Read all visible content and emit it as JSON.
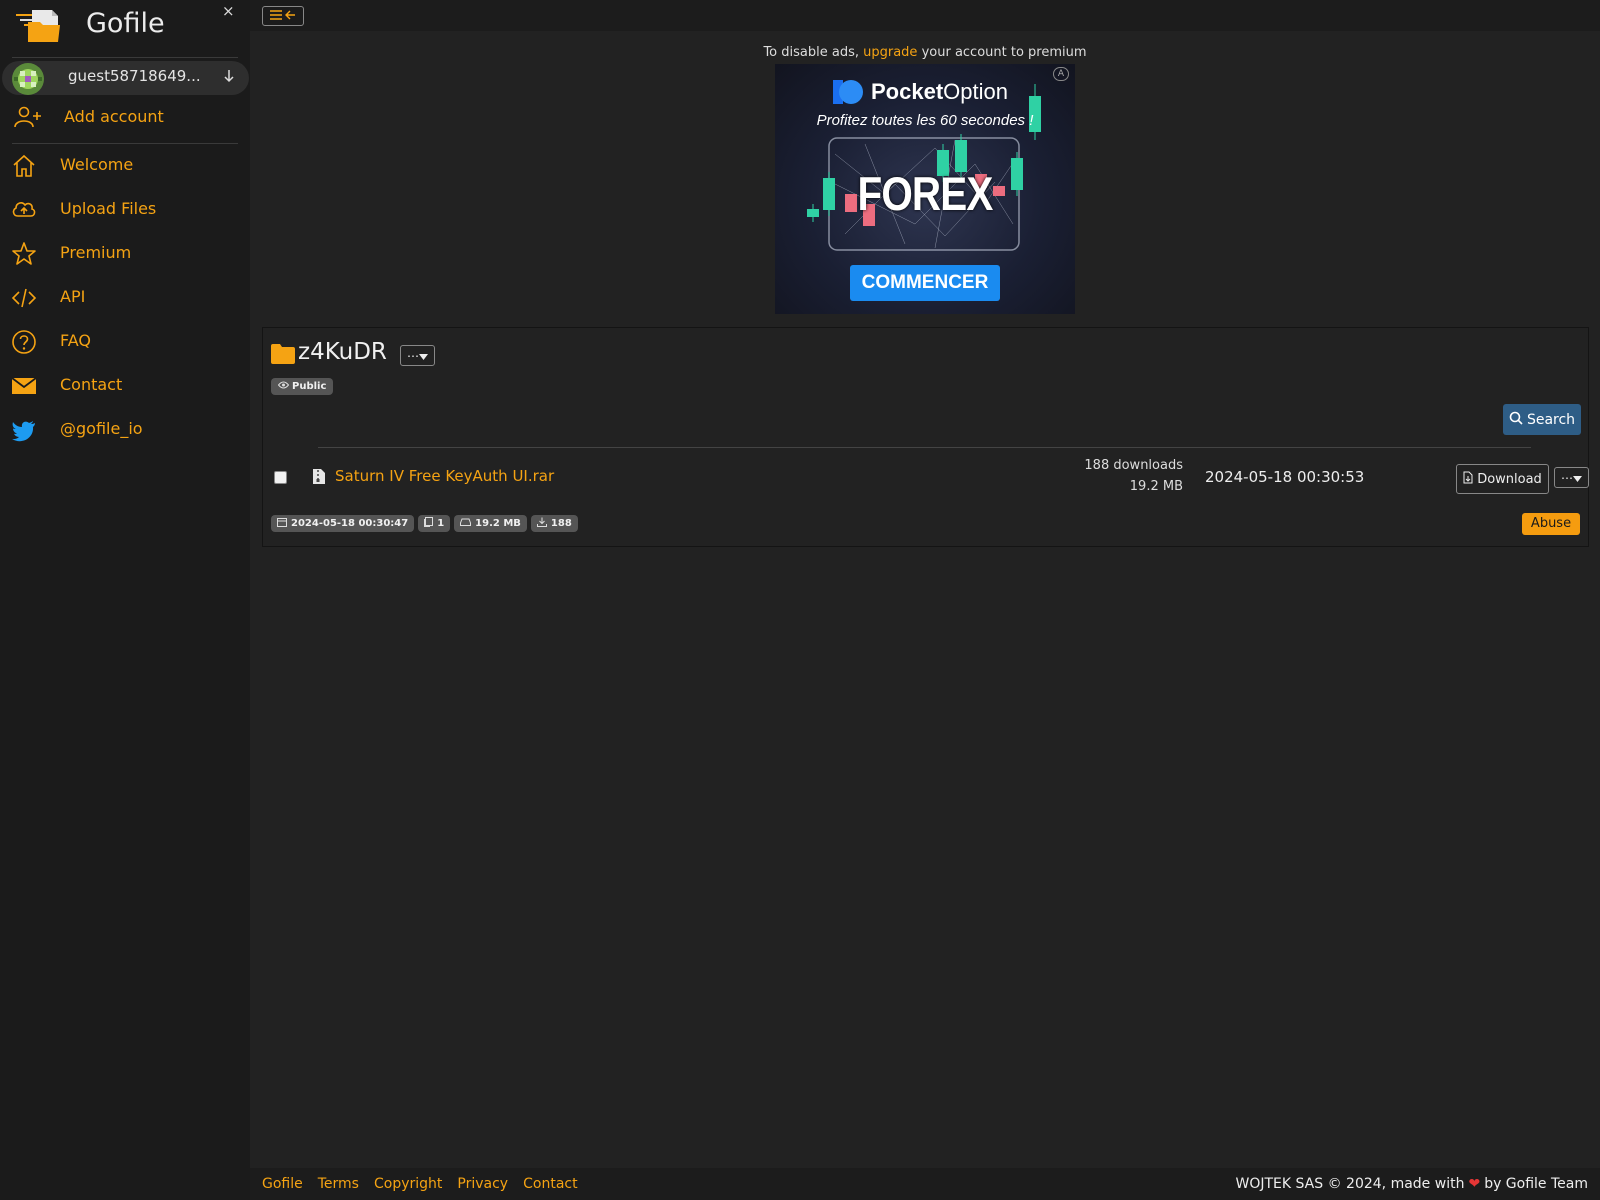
{
  "sidebar": {
    "brand": "Gofile",
    "close_glyph": "×",
    "account": {
      "name": "guest58718649..."
    },
    "add_account": "Add account",
    "nav": [
      {
        "label": "Welcome",
        "icon": "home-icon"
      },
      {
        "label": "Upload Files",
        "icon": "cloud-upload-icon"
      },
      {
        "label": "Premium",
        "icon": "star-icon"
      },
      {
        "label": "API",
        "icon": "code-icon"
      },
      {
        "label": "FAQ",
        "icon": "question-circle-icon"
      },
      {
        "label": "Contact",
        "icon": "envelope-icon"
      },
      {
        "label": "@gofile_io",
        "icon": "twitter-icon"
      }
    ]
  },
  "ad": {
    "notice_prefix": "To disable ads,",
    "notice_link": "upgrade",
    "notice_suffix": "your account to premium",
    "brand_bold": "Pocket",
    "brand_rest": "Option",
    "tagline": "Profitez toutes les 60 secondes !",
    "headline": "FOREX",
    "cta": "COMMENCER"
  },
  "folder": {
    "name": "z4KuDR",
    "visibility": "Public",
    "search_label": "Search",
    "files": [
      {
        "name": "Saturn IV Free KeyAuth UI.rar",
        "downloads": "188 downloads",
        "size": "19.2 MB",
        "date": "2024-05-18 00:30:53",
        "download_label": "Download"
      }
    ],
    "stats": {
      "created": "2024-05-18 00:30:47",
      "file_count": "1",
      "total_size": "19.2 MB",
      "total_downloads": "188"
    },
    "abuse_label": "Abuse"
  },
  "footer": {
    "links": [
      "Gofile",
      "Terms",
      "Copyright",
      "Privacy",
      "Contact"
    ],
    "copyright_prefix": "WOJTEK SAS © 2024, made with",
    "copyright_suffix": "by Gofile Team"
  },
  "colors": {
    "accent": "#f5a313",
    "background": "#222222",
    "sidebar": "#1b1b1b",
    "search_button": "#2e5d86",
    "abuse_button": "#f59c0f"
  }
}
